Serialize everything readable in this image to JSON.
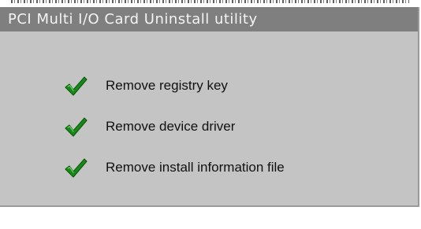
{
  "dialog": {
    "title": "PCI Multi I/O Card Uninstall utility"
  },
  "steps": [
    {
      "label": "Remove registry key",
      "icon": "checkmark-icon",
      "status": "done"
    },
    {
      "label": "Remove device driver",
      "icon": "checkmark-icon",
      "status": "done"
    },
    {
      "label": "Remove install information file",
      "icon": "checkmark-icon",
      "status": "done"
    }
  ],
  "colors": {
    "title_bar": "#7f7f7f",
    "title_text": "#f4f4f4",
    "dialog_bg": "#c4c4c4",
    "check_green": "#1a8f1a"
  }
}
